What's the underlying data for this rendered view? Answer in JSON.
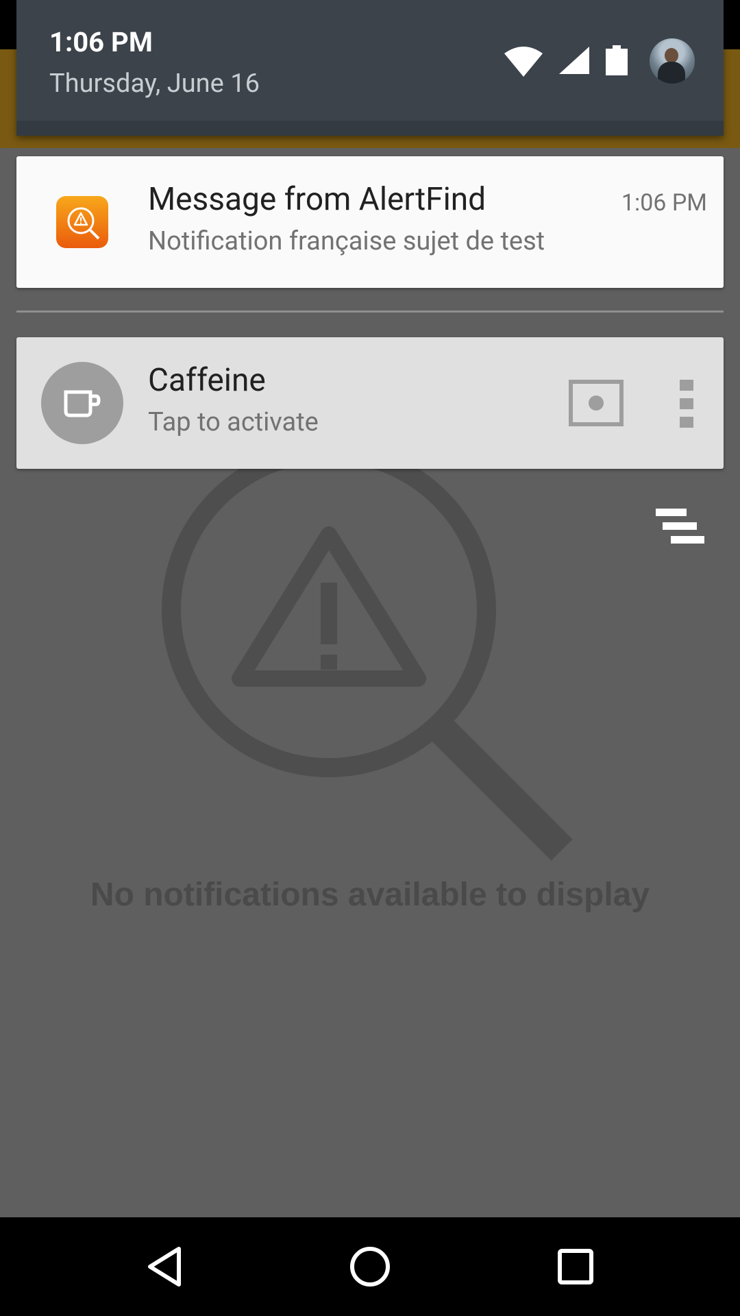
{
  "status_header": {
    "time": "1:06 PM",
    "date": "Thursday, June 16",
    "icons": [
      "wifi-icon",
      "cell-signal-icon",
      "battery-icon"
    ],
    "avatar": "user-avatar"
  },
  "notifications": [
    {
      "app_icon": "alertfind-icon",
      "title": "Message from AlertFind",
      "text": "Notification française sujet de test",
      "time": "1:06 PM"
    },
    {
      "app_icon": "coffee-cup-icon",
      "title": "Caffeine",
      "text": "Tap to activate",
      "actions": [
        "screen-icon",
        "more-vert-icon"
      ]
    }
  ],
  "background_app": {
    "empty_state_icon": "alert-search-icon",
    "empty_message": "No notifications available to display",
    "sort_icon": "sort-icon",
    "toolbar_color": "#7a5a12"
  },
  "navbar": {
    "buttons": [
      "back-icon",
      "home-icon",
      "recents-icon"
    ]
  },
  "colors": {
    "header_bg": "#3c434b",
    "alert_icon_gradient": [
      "#f8a81b",
      "#ea5b0c"
    ],
    "scrim": "#5f5f5f"
  }
}
